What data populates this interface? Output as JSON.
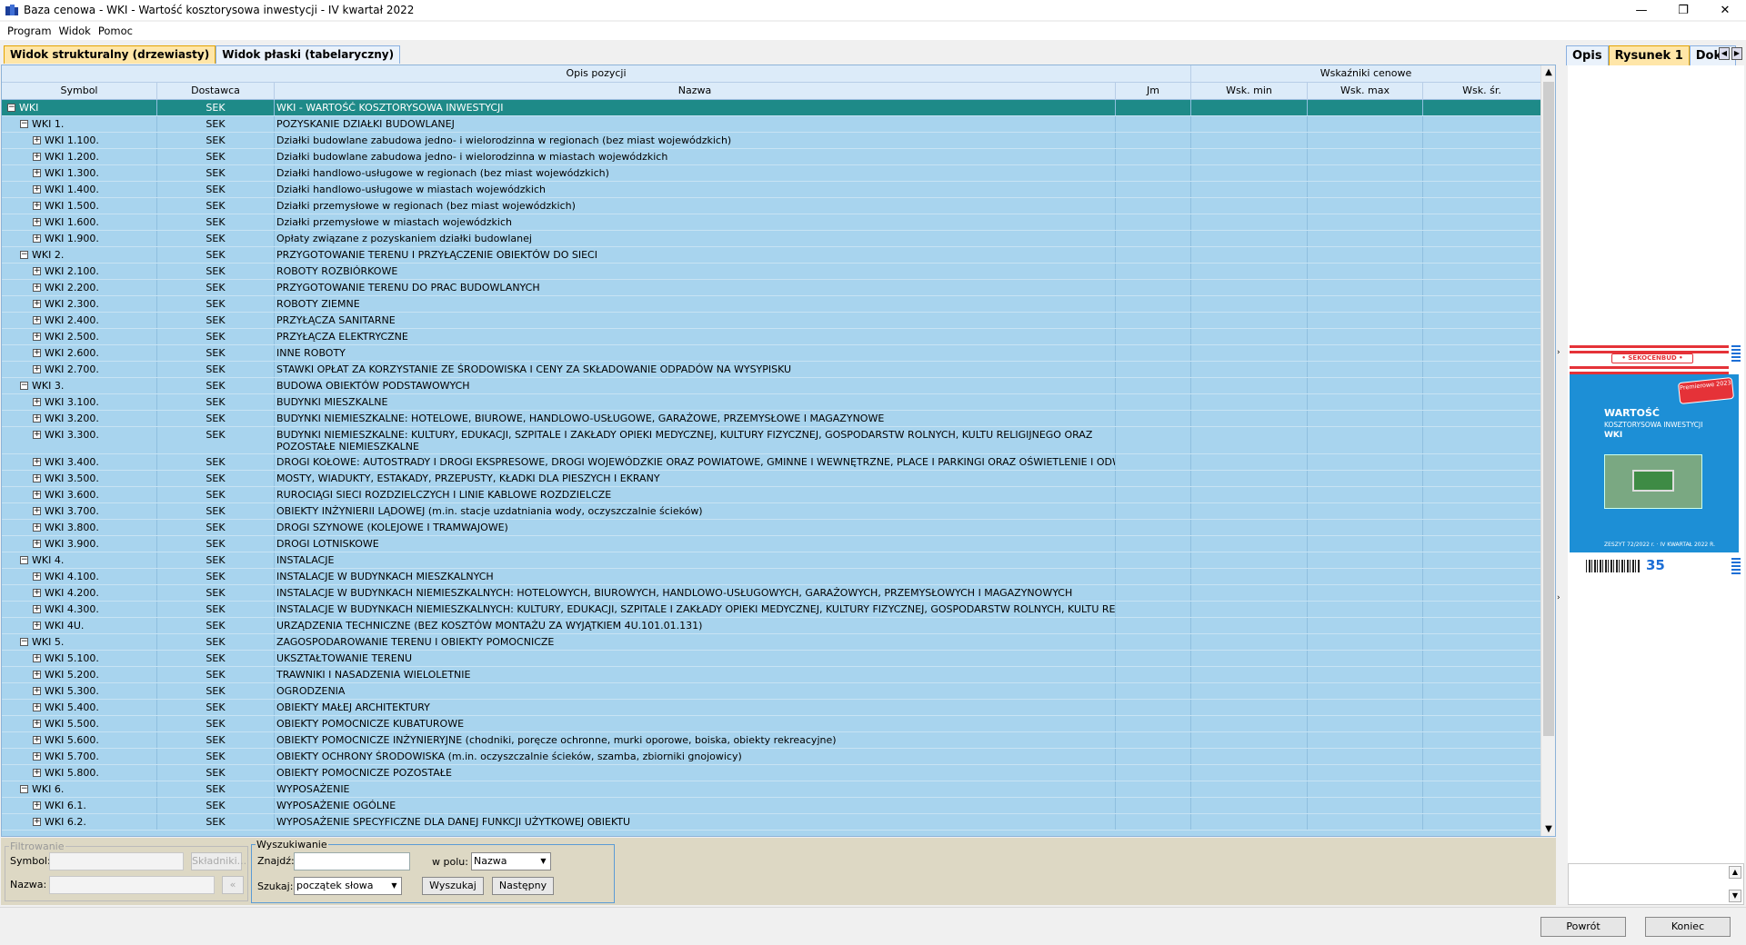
{
  "window": {
    "title": "Baza cenowa - WKI - Wartość kosztorysowa inwestycji - IV kwartał 2022",
    "minimize": "—",
    "restore": "❐",
    "close": "✕"
  },
  "menu": [
    "Program",
    "Widok",
    "Pomoc"
  ],
  "tabs": {
    "tree": "Widok strukturalny (drzewiasty)",
    "flat": "Widok płaski (tabelaryczny)"
  },
  "grid": {
    "group_headers": {
      "opis": "Opis pozycji",
      "wskazniki": "Wskaźniki cenowe"
    },
    "columns": {
      "symbol": "Symbol",
      "dostawca": "Dostawca",
      "nazwa": "Nazwa",
      "jm": "Jm",
      "wsk_min": "Wsk. min",
      "wsk_max": "Wsk. max",
      "wsk_sr": "Wsk. śr."
    },
    "rows": [
      {
        "level": 0,
        "expander": "−",
        "symbol": "WKI",
        "dostawca": "SEK",
        "nazwa": "WKI - WARTOŚĆ KOSZTORYSOWA INWESTYCJI",
        "selected": true
      },
      {
        "level": 1,
        "expander": "−",
        "symbol": "WKI 1.",
        "dostawca": "SEK",
        "nazwa": "POZYSKANIE DZIAŁKI BUDOWLANEJ"
      },
      {
        "level": 2,
        "expander": "+",
        "symbol": "WKI 1.100.",
        "dostawca": "SEK",
        "nazwa": "Działki budowlane zabudowa jedno- i wielorodzinna w regionach (bez miast wojewódzkich)"
      },
      {
        "level": 2,
        "expander": "+",
        "symbol": "WKI 1.200.",
        "dostawca": "SEK",
        "nazwa": "Działki budowlane zabudowa jedno- i wielorodzinna w miastach wojewódzkich"
      },
      {
        "level": 2,
        "expander": "+",
        "symbol": "WKI 1.300.",
        "dostawca": "SEK",
        "nazwa": "Działki handlowo-usługowe w regionach (bez miast wojewódzkich)"
      },
      {
        "level": 2,
        "expander": "+",
        "symbol": "WKI 1.400.",
        "dostawca": "SEK",
        "nazwa": "Działki handlowo-usługowe w miastach wojewódzkich"
      },
      {
        "level": 2,
        "expander": "+",
        "symbol": "WKI 1.500.",
        "dostawca": "SEK",
        "nazwa": "Działki przemysłowe w regionach (bez miast wojewódzkich)"
      },
      {
        "level": 2,
        "expander": "+",
        "symbol": "WKI 1.600.",
        "dostawca": "SEK",
        "nazwa": "Działki przemysłowe w miastach wojewódzkich"
      },
      {
        "level": 2,
        "expander": "+",
        "symbol": "WKI 1.900.",
        "dostawca": "SEK",
        "nazwa": "Opłaty związane z pozyskaniem działki budowlanej"
      },
      {
        "level": 1,
        "expander": "−",
        "symbol": "WKI 2.",
        "dostawca": "SEK",
        "nazwa": "PRZYGOTOWANIE TERENU I PRZYŁĄCZENIE OBIEKTÓW DO SIECI"
      },
      {
        "level": 2,
        "expander": "+",
        "symbol": "WKI 2.100.",
        "dostawca": "SEK",
        "nazwa": "ROBOTY ROZBIÓRKOWE"
      },
      {
        "level": 2,
        "expander": "+",
        "symbol": "WKI 2.200.",
        "dostawca": "SEK",
        "nazwa": "PRZYGOTOWANIE TERENU DO PRAC BUDOWLANYCH"
      },
      {
        "level": 2,
        "expander": "+",
        "symbol": "WKI 2.300.",
        "dostawca": "SEK",
        "nazwa": "ROBOTY ZIEMNE"
      },
      {
        "level": 2,
        "expander": "+",
        "symbol": "WKI 2.400.",
        "dostawca": "SEK",
        "nazwa": "PRZYŁĄCZA SANITARNE"
      },
      {
        "level": 2,
        "expander": "+",
        "symbol": "WKI 2.500.",
        "dostawca": "SEK",
        "nazwa": "PRZYŁĄCZA ELEKTRYCZNE"
      },
      {
        "level": 2,
        "expander": "+",
        "symbol": "WKI 2.600.",
        "dostawca": "SEK",
        "nazwa": "INNE ROBOTY"
      },
      {
        "level": 2,
        "expander": "+",
        "symbol": "WKI 2.700.",
        "dostawca": "SEK",
        "nazwa": "STAWKI OPŁAT ZA KORZYSTANIE ZE ŚRODOWISKA I CENY ZA SKŁADOWANIE ODPADÓW NA WYSYPISKU"
      },
      {
        "level": 1,
        "expander": "−",
        "symbol": "WKI 3.",
        "dostawca": "SEK",
        "nazwa": "BUDOWA OBIEKTÓW PODSTAWOWYCH"
      },
      {
        "level": 2,
        "expander": "+",
        "symbol": "WKI 3.100.",
        "dostawca": "SEK",
        "nazwa": "BUDYNKI MIESZKALNE"
      },
      {
        "level": 2,
        "expander": "+",
        "symbol": "WKI 3.200.",
        "dostawca": "SEK",
        "nazwa": "BUDYNKI NIEMIESZKALNE: HOTELOWE, BIUROWE, HANDLOWO-USŁUGOWE, GARAŻOWE, PRZEMYSŁOWE I MAGAZYNOWE"
      },
      {
        "level": 2,
        "expander": "+",
        "symbol": "WKI 3.300.",
        "dostawca": "SEK",
        "nazwa": "BUDYNKI NIEMIESZKALNE: KULTURY, EDUKACJI, SZPITALE I ZAKŁADY OPIEKI MEDYCZNEJ, KULTURY FIZYCZNEJ, GOSPODARSTW ROLNYCH, KULTU RELIGIJNEGO ORAZ POZOSTAŁE NIEMIESZKALNE",
        "tall": true
      },
      {
        "level": 2,
        "expander": "+",
        "symbol": "WKI 3.400.",
        "dostawca": "SEK",
        "nazwa": "DROGI KOŁOWE: AUTOSTRADY I DROGI EKSPRESOWE, DROGI WOJEWÓDZKIE ORAZ POWIATOWE, GMINNE I WEWNĘTRZNE, PLACE I PARKINGI ORAZ OŚWIETLENIE I ODWODNIENIE"
      },
      {
        "level": 2,
        "expander": "+",
        "symbol": "WKI 3.500.",
        "dostawca": "SEK",
        "nazwa": "MOSTY, WIADUKTY, ESTAKADY, PRZEPUSTY, KŁADKI DLA PIESZYCH I EKRANY"
      },
      {
        "level": 2,
        "expander": "+",
        "symbol": "WKI 3.600.",
        "dostawca": "SEK",
        "nazwa": "RUROCIĄGI SIECI ROZDZIELCZYCH I LINIE KABLOWE ROZDZIELCZE"
      },
      {
        "level": 2,
        "expander": "+",
        "symbol": "WKI 3.700.",
        "dostawca": "SEK",
        "nazwa": "OBIEKTY INŻYNIERII LĄDOWEJ (m.in. stacje uzdatniania wody, oczyszczalnie ścieków)"
      },
      {
        "level": 2,
        "expander": "+",
        "symbol": "WKI 3.800.",
        "dostawca": "SEK",
        "nazwa": "DROGI SZYNOWE (KOLEJOWE I TRAMWAJOWE)"
      },
      {
        "level": 2,
        "expander": "+",
        "symbol": "WKI 3.900.",
        "dostawca": "SEK",
        "nazwa": "DROGI LOTNISKOWE"
      },
      {
        "level": 1,
        "expander": "−",
        "symbol": "WKI 4.",
        "dostawca": "SEK",
        "nazwa": "INSTALACJE"
      },
      {
        "level": 2,
        "expander": "+",
        "symbol": "WKI 4.100.",
        "dostawca": "SEK",
        "nazwa": "INSTALACJE W BUDYNKACH MIESZKALNYCH"
      },
      {
        "level": 2,
        "expander": "+",
        "symbol": "WKI 4.200.",
        "dostawca": "SEK",
        "nazwa": "INSTALACJE W BUDYNKACH NIEMIESZKALNYCH: HOTELOWYCH, BIUROWYCH, HANDLOWO-USŁUGOWYCH, GARAŻOWYCH, PRZEMYSŁOWYCH I MAGAZYNOWYCH"
      },
      {
        "level": 2,
        "expander": "+",
        "symbol": "WKI 4.300.",
        "dostawca": "SEK",
        "nazwa": "INSTALACJE W BUDYNKACH NIEMIESZKALNYCH: KULTURY, EDUKACJI, SZPITALE I ZAKŁADY OPIEKI MEDYCZNEJ, KULTURY FIZYCZNEJ, GOSPODARSTW ROLNYCH, KULTU RELIGIJNEGO"
      },
      {
        "level": 2,
        "expander": "+",
        "symbol": "WKI 4U.",
        "dostawca": "SEK",
        "nazwa": "URZĄDZENIA TECHNICZNE (BEZ KOSZTÓW MONTAŻU ZA WYJĄTKIEM 4U.101.01.131)"
      },
      {
        "level": 1,
        "expander": "−",
        "symbol": "WKI 5.",
        "dostawca": "SEK",
        "nazwa": "ZAGOSPODAROWANIE TERENU I OBIEKTY POMOCNICZE"
      },
      {
        "level": 2,
        "expander": "+",
        "symbol": "WKI 5.100.",
        "dostawca": "SEK",
        "nazwa": "UKSZTAŁTOWANIE TERENU"
      },
      {
        "level": 2,
        "expander": "+",
        "symbol": "WKI 5.200.",
        "dostawca": "SEK",
        "nazwa": "TRAWNIKI I NASADZENIA WIELOLETNIE"
      },
      {
        "level": 2,
        "expander": "+",
        "symbol": "WKI 5.300.",
        "dostawca": "SEK",
        "nazwa": "OGRODZENIA"
      },
      {
        "level": 2,
        "expander": "+",
        "symbol": "WKI 5.400.",
        "dostawca": "SEK",
        "nazwa": "OBIEKTY MAŁEJ ARCHITEKTURY"
      },
      {
        "level": 2,
        "expander": "+",
        "symbol": "WKI 5.500.",
        "dostawca": "SEK",
        "nazwa": "OBIEKTY POMOCNICZE KUBATUROWE"
      },
      {
        "level": 2,
        "expander": "+",
        "symbol": "WKI 5.600.",
        "dostawca": "SEK",
        "nazwa": "OBIEKTY POMOCNICZE INŻYNIERYJNE (chodniki, poręcze ochronne, murki oporowe, boiska, obiekty rekreacyjne)"
      },
      {
        "level": 2,
        "expander": "+",
        "symbol": "WKI 5.700.",
        "dostawca": "SEK",
        "nazwa": "OBIEKTY OCHRONY ŚRODOWISKA (m.in. oczyszczalnie ścieków, szamba, zbiorniki gnojowicy)"
      },
      {
        "level": 2,
        "expander": "+",
        "symbol": "WKI 5.800.",
        "dostawca": "SEK",
        "nazwa": "OBIEKTY POMOCNICZE POZOSTAŁE"
      },
      {
        "level": 1,
        "expander": "−",
        "symbol": "WKI 6.",
        "dostawca": "SEK",
        "nazwa": "WYPOSAŻENIE"
      },
      {
        "level": 2,
        "expander": "+",
        "symbol": "WKI 6.1.",
        "dostawca": "SEK",
        "nazwa": "WYPOSAŻENIE OGÓLNE"
      },
      {
        "level": 2,
        "expander": "+",
        "symbol": "WKI 6.2.",
        "dostawca": "SEK",
        "nazwa": "WYPOSAŻENIE SPECYFICZNE DLA DANEJ FUNKCJI UŻYTKOWEJ OBIEKTU"
      }
    ]
  },
  "filter": {
    "legend": "Filtrowanie",
    "symbol_label": "Symbol:",
    "symbol_value": "",
    "nazwa_label": "Nazwa:",
    "nazwa_value": "",
    "skladniki": "Składniki...",
    "small_btn": "«"
  },
  "search": {
    "legend": "Wyszukiwanie",
    "znajdz_label": "Znajdź:",
    "znajdz_value": "",
    "w_polu_label": "w polu:",
    "w_polu_value": "Nazwa",
    "szukaj_label": "Szukaj:",
    "szukaj_value": "początek słowa",
    "find_btn": "Wyszukaj",
    "next_btn": "Następny"
  },
  "right_panel": {
    "tabs": [
      "Opis",
      "Rysunek 1",
      "Doku"
    ],
    "cover": {
      "brand": "• SEKOCENBUD •",
      "title": "WARTOŚĆ",
      "subtitle": "KOSZTORYSOWA INWESTYCJI",
      "abbr": "WKI",
      "badge": "Premierowe 2023",
      "footer": "ZESZYT 72/2022 r. · IV KWARTAŁ 2022 R.",
      "anniversary": "35"
    }
  },
  "footer": {
    "back": "Powrót",
    "end": "Koniec"
  },
  "colors": {
    "grid_bg": "#a8d4ee",
    "selected_row": "#1e8a88",
    "active_tab": "#ffe6a8",
    "bottom_panel": "#ddd8c4"
  }
}
